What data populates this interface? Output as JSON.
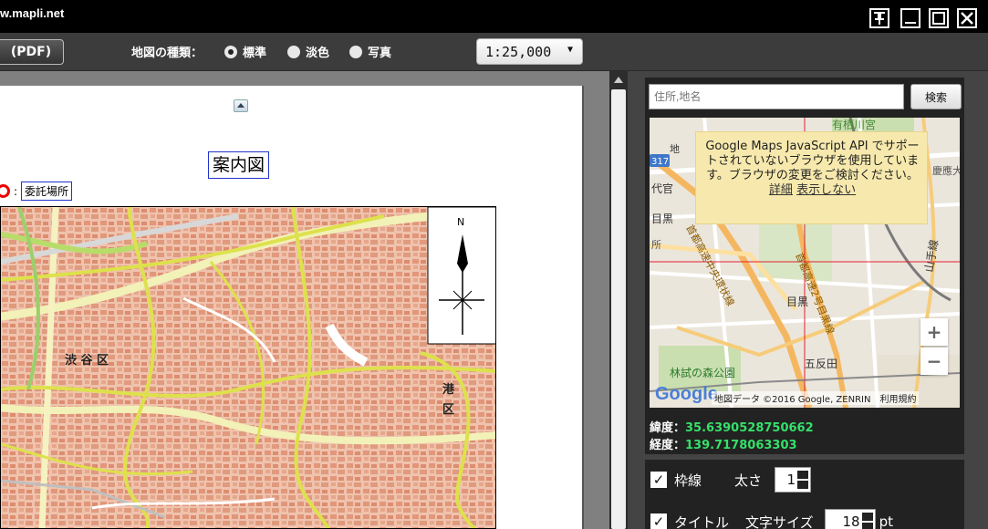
{
  "window": {
    "url": "w.mapli.net",
    "pin_icon": "pin-icon",
    "min_icon": "minimize-icon",
    "max_icon": "maximize-icon",
    "close_icon": "close-icon"
  },
  "toolbar": {
    "pdf_label": "(PDF)",
    "map_type_label": "地図の種類：",
    "map_types": [
      {
        "label": "標準",
        "selected": true
      },
      {
        "label": "淡色",
        "selected": false
      },
      {
        "label": "写真",
        "selected": false
      }
    ],
    "scale_value": "1:25,000"
  },
  "document": {
    "title": "案内図",
    "legend_colon": ":",
    "legend_label": "委託場所",
    "map_labels": {
      "compass_n": "N",
      "ward_shibuya": "渋 谷 区",
      "ward_minato_1": "港",
      "ward_minato_2": "区"
    }
  },
  "search": {
    "placeholder": "住所,地名",
    "button_label": "検索"
  },
  "gmap": {
    "warning_text": "Google Maps JavaScript API でサポートされていないブラウザを使用しています。ブラウザの変更をご検討ください。",
    "warning_link_detail": "詳細",
    "warning_link_hide": "表示しない",
    "zoom_in": "+",
    "zoom_out": "−",
    "logo": "Google",
    "attribution": "地図データ ©2016 Google, ZENRIN　利用規約",
    "labels": {
      "arisugawa": "有栖川宮",
      "daikanyama": "代官",
      "meguro_left": "目黒",
      "sho": "所",
      "meguro_station": "目黒",
      "gotanda": "五反田",
      "rinshi": "林試の森公園",
      "route_317": "317",
      "yamanote": "山手線",
      "keio": "慶應大",
      "chi": "地",
      "meguro_road": "首都高速2号目黒線",
      "chuo_kanjo": "首都高速中央環状線"
    }
  },
  "coords": {
    "lat_label": "緯度：",
    "lat_value": "35.6390528750662",
    "lng_label": "経度：",
    "lng_value": "139.7178063303"
  },
  "options": {
    "border_label": "枠線",
    "thickness_label": "太さ",
    "thickness_value": "1",
    "title_label": "タイトル",
    "font_size_label": "文字サイズ",
    "font_size_value": "18",
    "font_size_unit": "pt"
  },
  "colors": {
    "accent_green": "#35e06a",
    "title_box_border": "#2233cc",
    "legend_circle": "#ee0000"
  }
}
